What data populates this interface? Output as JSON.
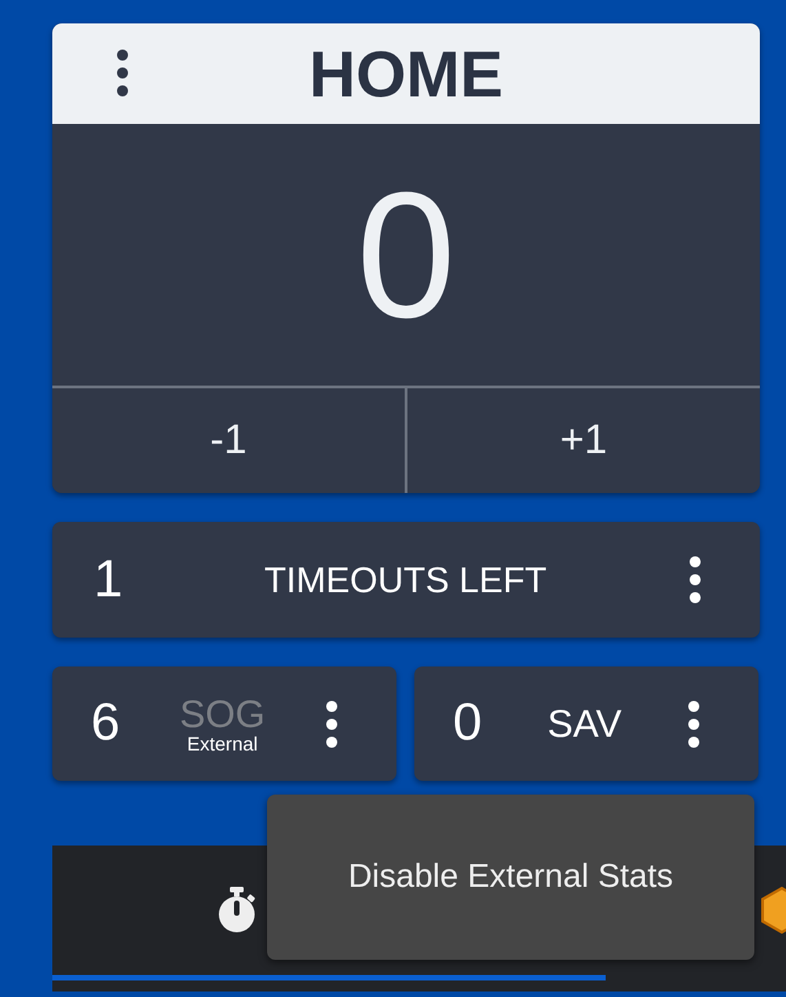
{
  "team": {
    "name": "HOME",
    "score": "0",
    "buttons": [
      "-1",
      "+1"
    ]
  },
  "timeouts": {
    "value": "1",
    "label": "TIMEOUTS LEFT"
  },
  "stats": [
    {
      "value": "6",
      "label": "SOG",
      "sublabel": "External",
      "external": true
    },
    {
      "value": "0",
      "label": "SAV",
      "external": false
    }
  ],
  "popup_menu": {
    "items": [
      "Disable External Stats"
    ]
  },
  "bottom_tabs": [
    {
      "kind": "stopwatch",
      "selected": true
    },
    {
      "kind": "cube",
      "selected": false
    }
  ]
}
